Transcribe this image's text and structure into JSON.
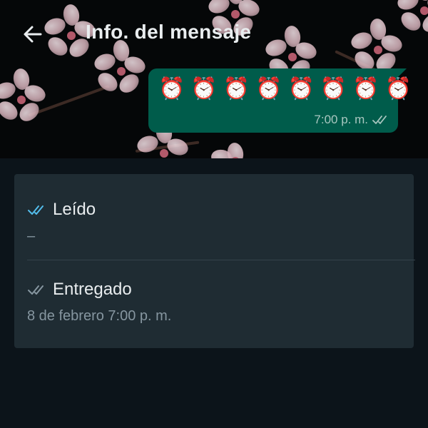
{
  "header": {
    "title": "Info. del mensaje"
  },
  "message": {
    "emojis": [
      "⏰",
      "⏰",
      "⏰",
      "⏰",
      "⏰",
      "⏰",
      "⏰",
      "⏰"
    ],
    "time": "7:00 p. m.",
    "status_icon": "double-check-icon"
  },
  "info": {
    "read": {
      "label": "Leído",
      "value": "–",
      "icon": "double-check-blue-icon",
      "icon_color": "#53bdeb"
    },
    "delivered": {
      "label": "Entregado",
      "value": "8 de febrero 7:00 p. m.",
      "icon": "double-check-gray-icon",
      "icon_color": "#8696a0"
    }
  },
  "colors": {
    "bubble": "#005c4b",
    "card": "#1f2c33",
    "background": "#0c141a"
  }
}
